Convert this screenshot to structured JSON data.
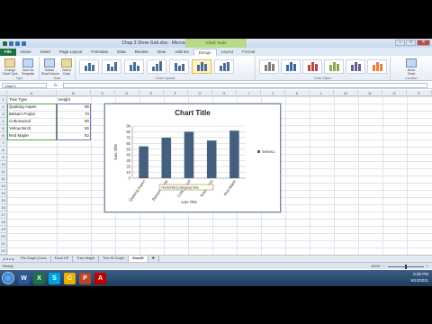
{
  "window": {
    "title": "Chap 3 Show Grid.xlsx - Microsoft Excel",
    "context_title": "Chart Tools",
    "minimize": "–",
    "maximize": "□",
    "close": "✕"
  },
  "tabs": [
    {
      "label": "File"
    },
    {
      "label": "Home"
    },
    {
      "label": "Insert"
    },
    {
      "label": "Page Layout"
    },
    {
      "label": "Formulas"
    },
    {
      "label": "Data"
    },
    {
      "label": "Review"
    },
    {
      "label": "View"
    },
    {
      "label": "Add-Ins"
    },
    {
      "label": "Design"
    },
    {
      "label": "Layout"
    },
    {
      "label": "Format"
    }
  ],
  "ribbon": {
    "type_group": "Type",
    "change_chart_type": "Change Chart Type",
    "save_as_template": "Save As Template",
    "data_group": "Data",
    "switch_row_column": "Switch Row/Column",
    "select_data": "Select Data",
    "chart_layouts_group": "Chart Layouts",
    "chart_styles_group": "Chart Styles",
    "location_group": "Location",
    "move_chart": "Move Chart"
  },
  "formula_bar": {
    "name_box": "Chart 1",
    "fx": "fx",
    "value": ""
  },
  "columns": [
    "A",
    "B",
    "C",
    "D",
    "E",
    "F",
    "G",
    "H",
    "I",
    "J",
    "K",
    "L",
    "M",
    "N",
    "O",
    "P"
  ],
  "rows": [
    "1",
    "2",
    "3",
    "4",
    "5",
    "6",
    "7",
    "8",
    "9",
    "10",
    "11",
    "12",
    "13",
    "14",
    "15",
    "16",
    "17",
    "18",
    "19",
    "20",
    "21",
    "22"
  ],
  "table": {
    "header": {
      "type": "Tree Type",
      "height": "Height"
    },
    "rows": [
      {
        "type": "Quaking Aspen",
        "height": "55"
      },
      {
        "type": "Balsam Poplar",
        "height": "70"
      },
      {
        "type": "Cottonwood",
        "height": "80"
      },
      {
        "type": "Yellow Birch",
        "height": "65"
      },
      {
        "type": "Red Maple",
        "height": "82"
      }
    ]
  },
  "chart_data": {
    "type": "bar",
    "title": "Chart Title",
    "xlabel": "Axis Title",
    "ylabel": "Axis Title",
    "categories": [
      "Quaking Aspen",
      "Balsam Poplar",
      "Cottonwood",
      "Yellow Birch",
      "Red Maple"
    ],
    "series": [
      {
        "name": "Series1",
        "values": [
          55,
          70,
          80,
          65,
          82
        ],
        "color": "#44607e"
      }
    ],
    "ylim": [
      0,
      90
    ],
    "yticks": [
      "0",
      "10",
      "20",
      "30",
      "40",
      "50",
      "60",
      "70",
      "80",
      "90"
    ],
    "grid": true,
    "legend": "right",
    "tooltip": "Horizontal (Category) Axis"
  },
  "sheets": [
    {
      "label": "Pie Graph (Cone"
    },
    {
      "label": "Excel HP"
    },
    {
      "label": "Tree Height"
    },
    {
      "label": "Tree Ht Graph"
    },
    {
      "label": "Sheet5"
    }
  ],
  "status": {
    "text": "Ready",
    "zoom": "100%"
  },
  "taskbar": {
    "apps": [
      {
        "label": "W",
        "color": "#2b5797"
      },
      {
        "label": "X",
        "color": "#1e7145"
      },
      {
        "label": "S",
        "color": "#00a3e0"
      },
      {
        "label": "C",
        "color": "#e8b100"
      },
      {
        "label": "P",
        "color": "#b7472a"
      },
      {
        "label": "A",
        "color": "#c00000"
      }
    ],
    "time": "5:30 PM",
    "date": "5/12/2011"
  }
}
